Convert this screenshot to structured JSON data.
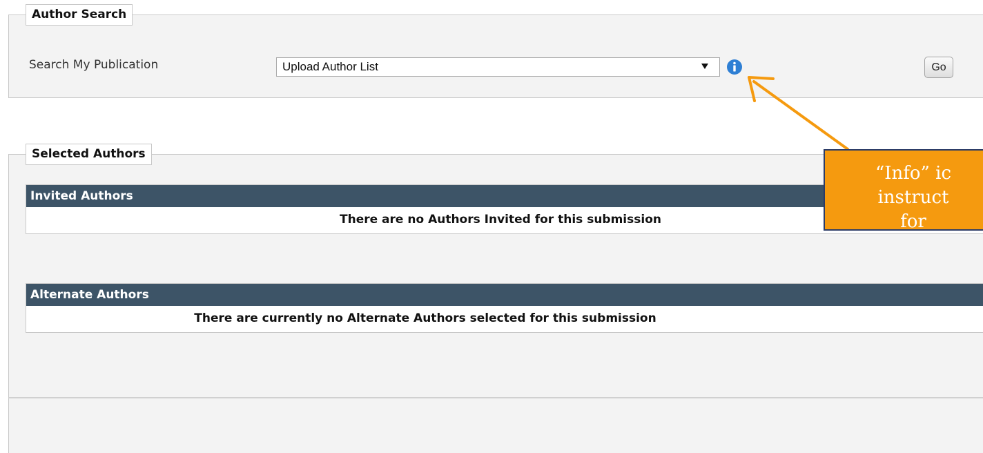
{
  "author_search": {
    "legend": "Author Search",
    "field_label": "Search My Publication",
    "select_value": "Upload Author List",
    "go_label": "Go"
  },
  "selected_authors": {
    "legend": "Selected Authors",
    "invited": {
      "header": "Invited Authors",
      "empty_message": "There are no Authors Invited for this submission"
    },
    "alternate": {
      "header": "Alternate Authors",
      "empty_message": "There are currently no Alternate Authors selected for this submission"
    }
  },
  "callout": {
    "line1": "“Info” ic",
    "line2": "instruct",
    "line3": "for"
  },
  "colors": {
    "table_header_bg": "#3d5467",
    "callout_bg": "#f59a0f",
    "callout_border": "#2b3b66",
    "arrow": "#f59a0f",
    "info_icon": "#2e7fd4"
  },
  "icons": [
    "info-icon",
    "dropdown-caret-icon",
    "arrow-annotation"
  ]
}
